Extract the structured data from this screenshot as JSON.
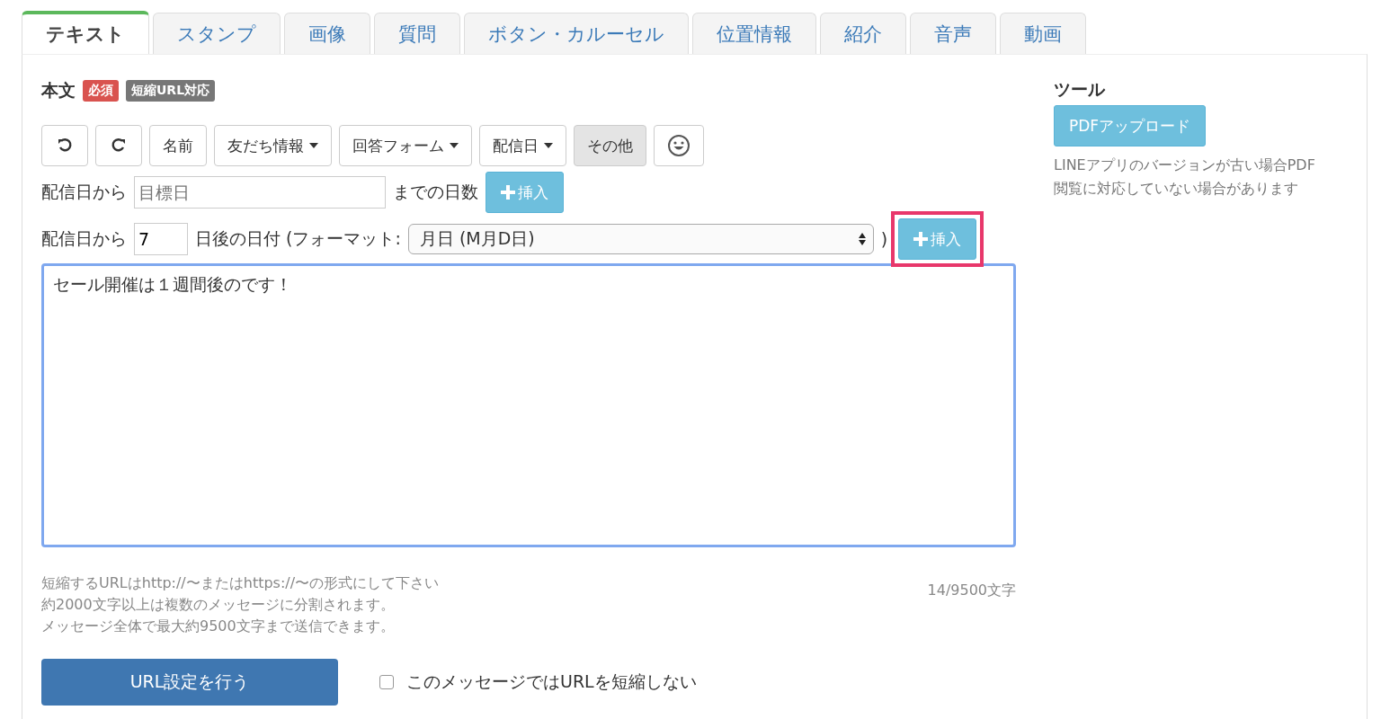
{
  "tabs": [
    {
      "label": "テキスト",
      "selected": true
    },
    {
      "label": "スタンプ",
      "selected": false
    },
    {
      "label": "画像",
      "selected": false
    },
    {
      "label": "質問",
      "selected": false
    },
    {
      "label": "ボタン・カルーセル",
      "selected": false
    },
    {
      "label": "位置情報",
      "selected": false
    },
    {
      "label": "紹介",
      "selected": false
    },
    {
      "label": "音声",
      "selected": false
    },
    {
      "label": "動画",
      "selected": false
    }
  ],
  "body": {
    "title": "本文",
    "badges": [
      {
        "label": "必須",
        "color": "#d9534f"
      },
      {
        "label": "短縮URL対応",
        "color": "#777777"
      }
    ],
    "toolbar": [
      {
        "kind": "undo",
        "active": false
      },
      {
        "kind": "redo",
        "active": false
      },
      {
        "kind": "text",
        "label": "名前",
        "active": false
      },
      {
        "kind": "dropdown",
        "label": "友だち情報",
        "active": false
      },
      {
        "kind": "dropdown",
        "label": "回答フォーム",
        "active": false
      },
      {
        "kind": "dropdown",
        "label": "配信日",
        "active": false
      },
      {
        "kind": "text",
        "label": "その他",
        "active": true
      },
      {
        "kind": "emoji",
        "active": false
      }
    ],
    "days_until": {
      "prefix": "配信日から",
      "placeholder": "目標日",
      "suffix": "までの日数",
      "button": "挿入",
      "highlighted": false
    },
    "days_after": {
      "prefix": "配信日から",
      "value": "7",
      "middle": "日後の日付 (フォーマット:",
      "format": "月日 (M月D日)",
      "close": ")",
      "button": "挿入",
      "highlighted": true
    },
    "message": "セール開催は１週間後のです！",
    "notes": [
      "短縮するURLはhttp://〜またはhttps://〜の形式にして下さい",
      "約2000文字以上は複数のメッセージに分割されます。",
      "メッセージ全体で最大約9500文字まで送信できます。"
    ],
    "counter": "14/9500文字",
    "url_button": "URL設定を行う",
    "no_shorten": {
      "label": "このメッセージではURLを短縮しない",
      "checked": false
    }
  },
  "tools": {
    "title": "ツール",
    "button": "PDFアップロード",
    "note": [
      "LINEアプリのバージョンが古い場合PDF",
      "閲覧に対応していない場合があります"
    ]
  }
}
